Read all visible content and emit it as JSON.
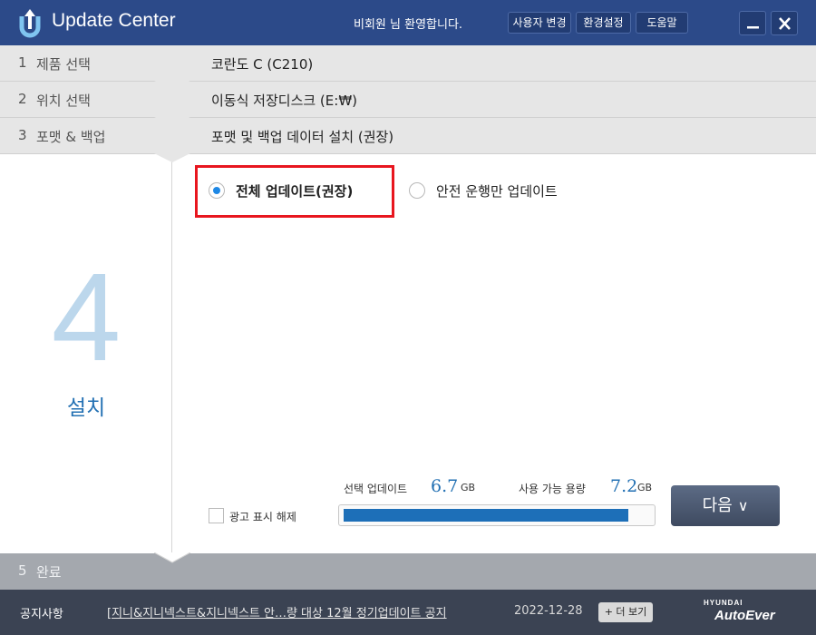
{
  "header": {
    "title": "Update Center",
    "welcome": "비회원  님 환영합니다.",
    "buttons": {
      "user_change": "사용자 변경",
      "settings": "환경설정",
      "help": "도움말"
    }
  },
  "steps": [
    {
      "num": "1",
      "label": "제품 선택",
      "value": "코란도 C (C210)"
    },
    {
      "num": "2",
      "label": "위치 선택",
      "value": "이동식 저장디스크 (E:₩)"
    },
    {
      "num": "3",
      "label": "포맷 & 백업",
      "value": "포맷 및 백업 데이터 설치 (권장)"
    }
  ],
  "current_step": {
    "num": "4",
    "label": "설치"
  },
  "options": [
    {
      "label": "전체 업데이트(권장)",
      "selected": true
    },
    {
      "label": "안전 운행만 업데이트",
      "selected": false
    }
  ],
  "ad_toggle": {
    "label": "광고 표시 해제",
    "checked": false
  },
  "capacity": {
    "selected_label": "선택 업데이트",
    "selected_value": "6.7",
    "selected_unit": "GB",
    "available_label": "사용 가능 용량",
    "available_value": "7.2",
    "available_unit": "GB",
    "fill_fraction": 0.93
  },
  "next_button": {
    "label": "다음",
    "icon": "double-chevron-down"
  },
  "step5": {
    "num": "5",
    "label": "완료"
  },
  "footer": {
    "notice_title": "공지사항",
    "notice_text": "[지니&지니넥스트&지니넥스트  안…량 대상 12월 정기업데이트 공지",
    "notice_date": "2022-12-28",
    "more_label": "+ 더 보기",
    "brand_top": "HYUNDAI",
    "brand_main": "AutoEver"
  },
  "colors": {
    "header": "#2c4a89",
    "accent": "#2270b3",
    "progress": "#1d6fb8",
    "highlight": "#e8161f",
    "footer": "#3b4353"
  }
}
